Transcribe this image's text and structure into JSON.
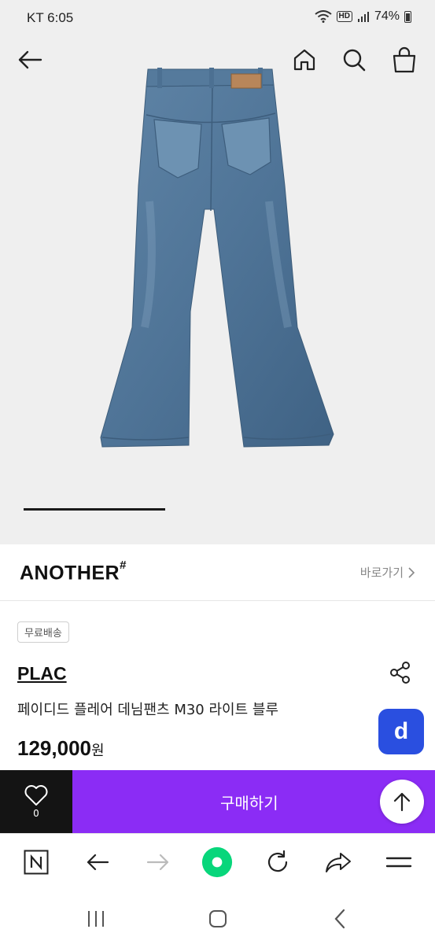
{
  "status_bar": {
    "carrier_time": "KT 6:05",
    "hd": "HD",
    "battery": "74%"
  },
  "header_icons": [
    "back-arrow-icon",
    "home-icon",
    "search-icon",
    "shopping-bag-icon"
  ],
  "brand": {
    "name": "ANOTHER",
    "mark": "#",
    "goto_label": "바로가기"
  },
  "product": {
    "badge": "무료배송",
    "seller": "PLAC",
    "name": "페이디드 플레어 데님팬츠 M30 라이트 블루",
    "price": "129,000",
    "price_unit": "원",
    "fab_letter": "d"
  },
  "buy_bar": {
    "like_count": "0",
    "buy_label": "구매하기"
  },
  "browser_toolbar": [
    "naver-n-icon",
    "back-icon",
    "forward-icon",
    "green-dot-icon",
    "refresh-icon",
    "share-icon",
    "menu-icon"
  ],
  "colors": {
    "accent": "#8b2cf5",
    "fab_blue": "#2a4fe0",
    "browser_green": "#08d67b"
  }
}
